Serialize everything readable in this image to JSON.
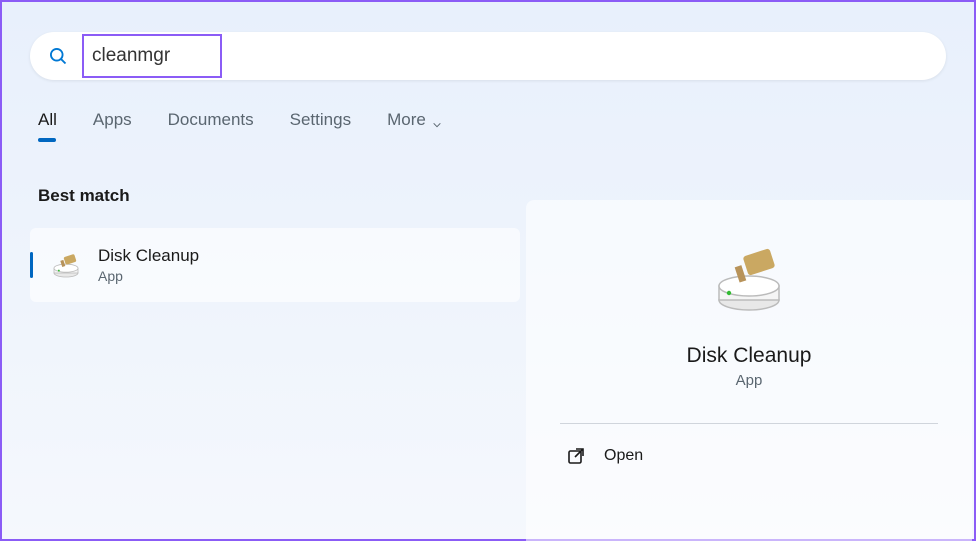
{
  "search": {
    "value": "cleanmgr"
  },
  "tabs": {
    "all": "All",
    "apps": "Apps",
    "documents": "Documents",
    "settings": "Settings",
    "more": "More"
  },
  "section": {
    "best_match": "Best match"
  },
  "result": {
    "title": "Disk Cleanup",
    "subtitle": "App"
  },
  "detail": {
    "title": "Disk Cleanup",
    "subtitle": "App",
    "open_label": "Open"
  }
}
